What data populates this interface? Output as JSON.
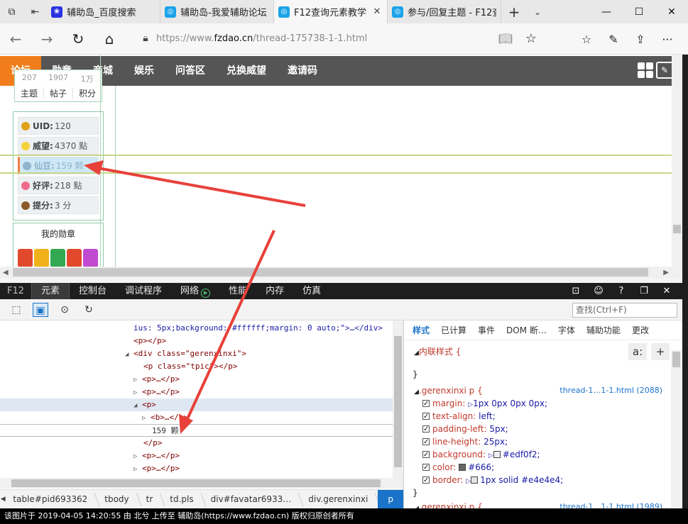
{
  "browser": {
    "tabs": [
      {
        "label": "辅助岛_百度搜索",
        "icon": "baidu-icon",
        "active": false
      },
      {
        "label": "辅助岛-我爱辅助论坛",
        "icon": "site-icon",
        "active": false
      },
      {
        "label": "F12查询元素教学",
        "icon": "site-icon",
        "active": true
      },
      {
        "label": "参与/回复主题 - F12查",
        "icon": "site-icon",
        "active": false
      }
    ],
    "url_prefix": "https://www.",
    "url_domain": "fzdao.cn",
    "url_path": "/thread-175738-1-1.html"
  },
  "site": {
    "nav": [
      "论坛",
      "勋章",
      "商城",
      "娱乐",
      "问答区",
      "兑换威望",
      "邀请码"
    ],
    "stats_values": [
      "207",
      "1907",
      "1万"
    ],
    "stats_labels": [
      "主题",
      "帖子",
      "积分"
    ],
    "info_rows": [
      {
        "label": "UID:",
        "value": "120",
        "color": "#e0a11a"
      },
      {
        "label": "威望:",
        "value": "4370 點",
        "color": "#f5d23a"
      },
      {
        "label": "仙豆:",
        "value": "159 颗",
        "color": "#8fb4cc",
        "highlight": true
      },
      {
        "label": "好评:",
        "value": "218 點",
        "color": "#f06b8b"
      },
      {
        "label": "提分:",
        "value": "3 分",
        "color": "#8a5a2b"
      }
    ],
    "medal_title": "我的勋章",
    "medal_colors": [
      "#e0492c",
      "#f0b21a",
      "#33a852",
      "#e2492c",
      "#c04ad0"
    ]
  },
  "devtools": {
    "f12_label": "F12",
    "tabs": [
      "元素",
      "控制台",
      "调试程序",
      "网络",
      "性能",
      "内存",
      "仿真"
    ],
    "active_tab": "元素",
    "search_placeholder": "查找(Ctrl+F)",
    "dom_lines": [
      {
        "text": "ius: 5px;background: #ffffff;margin: 0 auto;\">…</div>"
      },
      {
        "text": "<p></p>"
      },
      {
        "text": "<div class=\"gerenxinxi\">"
      },
      {
        "text": "<p class=\"tpic\"></p>"
      },
      {
        "text": "<p>…</p>"
      },
      {
        "text": "<p>…</p>"
      },
      {
        "text": "<p>"
      },
      {
        "text": "<b>…</b>"
      },
      {
        "text": "159 颗"
      },
      {
        "text": "</p>"
      },
      {
        "text": "<p>…</p>"
      },
      {
        "text": "<p>…</p>"
      }
    ],
    "breadcrumbs": [
      "table#pid693362",
      "tbody",
      "tr",
      "td.pls",
      "div#favatar6933…",
      "div.gerenxinxi",
      "p"
    ],
    "style_tabs": [
      "样式",
      "已计算",
      "事件",
      "DOM 断…",
      "字体",
      "辅助功能",
      "更改"
    ],
    "inline_rule": "内联样式  {",
    "close_brace": "}",
    "rule_selector": ".gerenxinxi p  {",
    "rule_source": "thread-1…1-1.html (2088)",
    "next_rule_selector": ".gerenxinxi p  {",
    "next_rule_source": "thread-1…1-1.html (1989)",
    "props": [
      {
        "name": "margin:",
        "value": "1px 0px 0px 0px;",
        "expand": true
      },
      {
        "name": "text-align:",
        "value": "left;"
      },
      {
        "name": "padding-left:",
        "value": "5px;"
      },
      {
        "name": "line-height:",
        "value": "25px;"
      },
      {
        "name": "background:",
        "value": "#edf0f2;",
        "swatch": "#edf0f2",
        "expand": true
      },
      {
        "name": "color:",
        "value": "#666;",
        "swatch": "#666666"
      },
      {
        "name": "border:",
        "value": "1px solid #e4e4e4;",
        "swatch": "#e4e4e4",
        "expand": true
      }
    ]
  },
  "caption": "该图片于 2019-04-05 14:20:55 由 北兮 上传至 辅助岛(https://www.fzdao.cn) 版权归原创者所有",
  "annotation_color": "#e8413a"
}
